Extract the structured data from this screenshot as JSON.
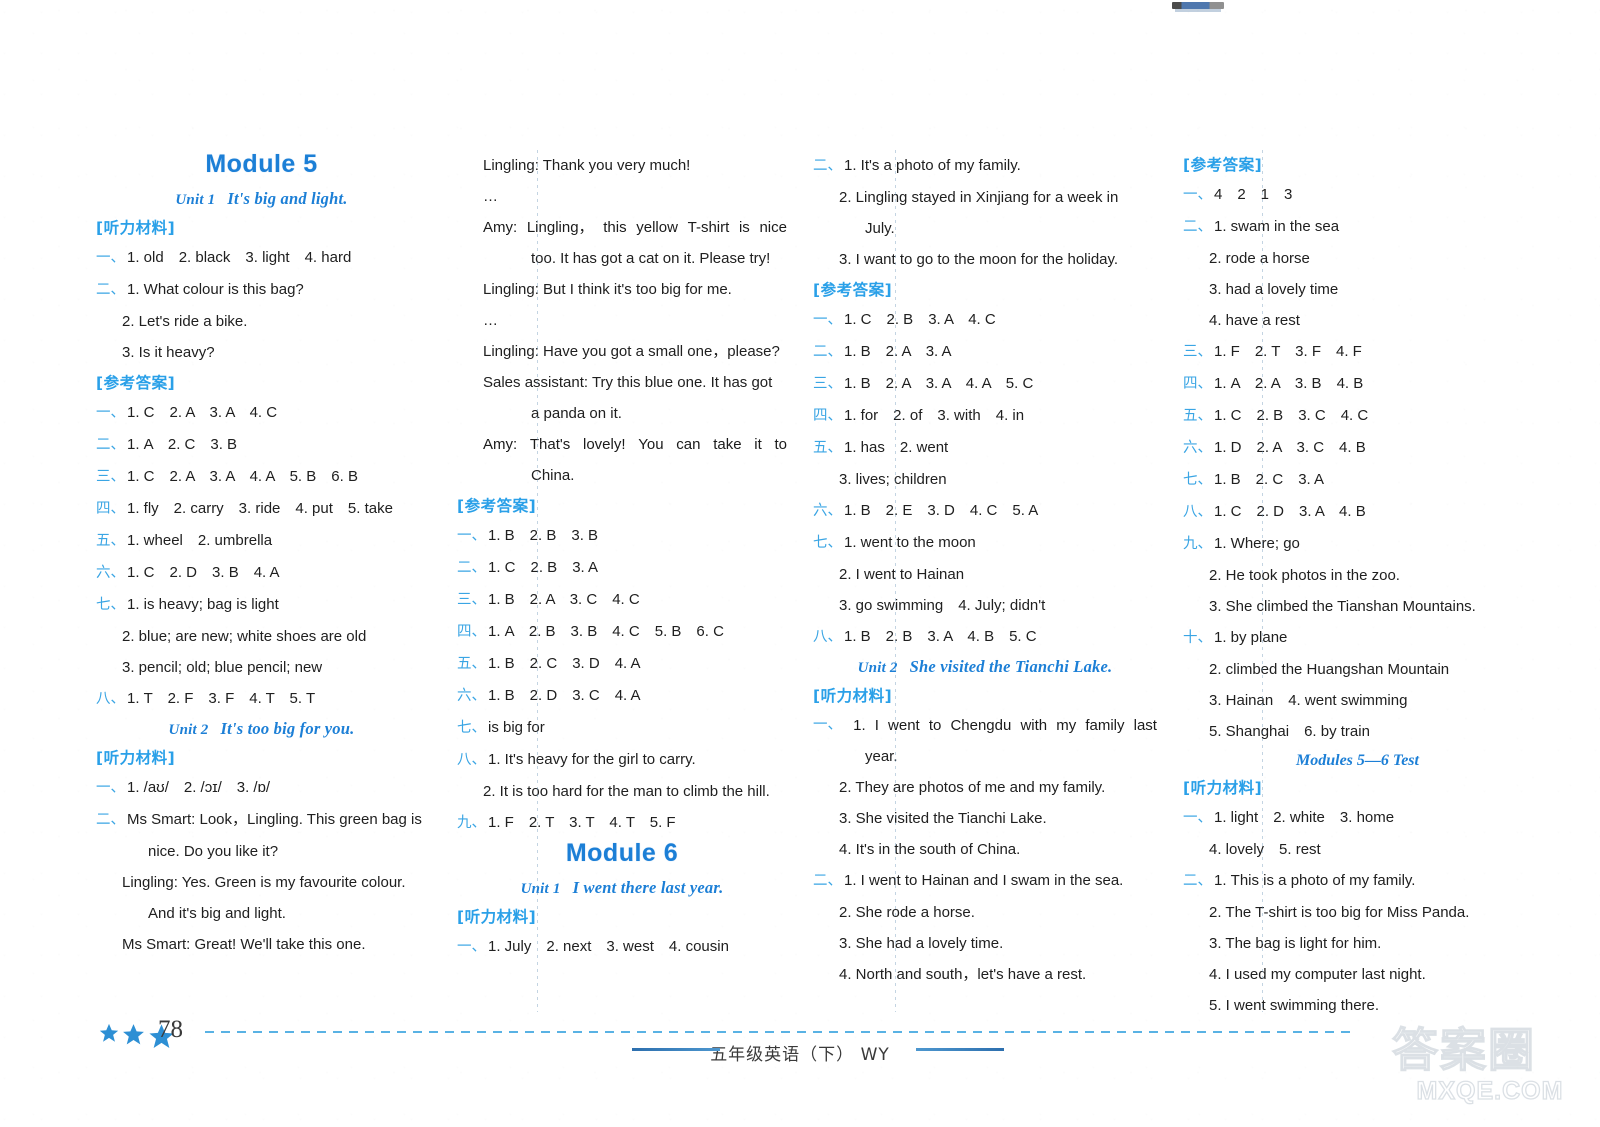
{
  "page": {
    "number": "78",
    "footer_center": "五年级英语（下）  WY",
    "watermark_cn": "答案圈",
    "watermark_en": "MXQE.COM"
  },
  "labels": {
    "listening": "[听力材料]",
    "answers": "[参考答案]"
  },
  "columns": [
    {
      "id": "col-1",
      "blocks": [
        {
          "type": "module",
          "text": "Module 5"
        },
        {
          "type": "unit",
          "no": "Unit 1",
          "title": "It's big and light."
        },
        {
          "type": "head",
          "key": "listening"
        },
        {
          "type": "line",
          "cn": "一",
          "text": "1. old　2. black　3. light　4. hard"
        },
        {
          "type": "line",
          "cn": "二",
          "text": "1. What colour is this bag?"
        },
        {
          "type": "line",
          "indent": 1,
          "text": "2. Let's ride a bike."
        },
        {
          "type": "line",
          "indent": 1,
          "text": "3. Is it heavy?"
        },
        {
          "type": "head",
          "key": "answers"
        },
        {
          "type": "line",
          "cn": "一",
          "text": "1. C　2. A　3. A　4. C"
        },
        {
          "type": "line",
          "cn": "二",
          "text": "1. A　2. C　3. B"
        },
        {
          "type": "line",
          "cn": "三",
          "text": "1. C　2. A　3. A　4. A　5. B　6. B"
        },
        {
          "type": "line",
          "cn": "四",
          "text": "1. fly　2. carry　3. ride　4. put　5. take"
        },
        {
          "type": "line",
          "cn": "五",
          "text": "1. wheel　2. umbrella"
        },
        {
          "type": "line",
          "cn": "六",
          "text": "1. C　2. D　3. B　4. A"
        },
        {
          "type": "line",
          "cn": "七",
          "text": "1. is heavy; bag is light"
        },
        {
          "type": "line",
          "indent": 1,
          "text": "2. blue; are new; white shoes are old"
        },
        {
          "type": "line",
          "indent": 1,
          "text": "3. pencil; old; blue pencil; new"
        },
        {
          "type": "line",
          "cn": "八",
          "text": "1. T　2. F　3. F　4. T　5. T"
        },
        {
          "type": "unit",
          "no": "Unit 2",
          "title": "It's too big for you."
        },
        {
          "type": "head",
          "key": "listening"
        },
        {
          "type": "line",
          "cn": "一",
          "text": "1. /aʊ/　2. /ɔɪ/　3. /ɒ/"
        },
        {
          "type": "line",
          "cn": "二",
          "text": "Ms Smart: Look，Lingling. This green bag is"
        },
        {
          "type": "line",
          "indent": 2,
          "text": "nice. Do you like it?"
        },
        {
          "type": "line",
          "indent": 1,
          "text": "Lingling: Yes. Green is my favourite colour."
        },
        {
          "type": "line",
          "indent": 2,
          "text": "And it's big and light."
        },
        {
          "type": "line",
          "indent": 1,
          "text": "Ms Smart: Great! We'll take this one."
        }
      ]
    },
    {
      "id": "col-2",
      "blocks": [
        {
          "type": "line",
          "indent": 1,
          "text": "Lingling: Thank you very much!"
        },
        {
          "type": "line",
          "indent": 1,
          "text": "…"
        },
        {
          "type": "just",
          "indent": 1,
          "words": [
            "Amy:",
            "Lingling，",
            "this",
            "yellow",
            "T-shirt",
            "is",
            "nice"
          ]
        },
        {
          "type": "line",
          "indent": 3,
          "text": "too. It has got a cat on it. Please try!"
        },
        {
          "type": "line",
          "indent": 1,
          "text": "Lingling: But I think it's too big for me."
        },
        {
          "type": "line",
          "indent": 1,
          "text": "…"
        },
        {
          "type": "line",
          "indent": 1,
          "text": "Lingling: Have you got a small one，please?"
        },
        {
          "type": "line",
          "indent": 1,
          "text": "Sales assistant: Try this blue one. It has got"
        },
        {
          "type": "line",
          "indent": 3,
          "text": "a panda on it."
        },
        {
          "type": "just",
          "indent": 1,
          "words": [
            "Amy:",
            "That's",
            "lovely!",
            "You",
            "can",
            "take",
            "it",
            "to"
          ]
        },
        {
          "type": "line",
          "indent": 3,
          "text": "China."
        },
        {
          "type": "head",
          "key": "answers"
        },
        {
          "type": "line",
          "cn": "一",
          "text": "1. B　2. B　3. B"
        },
        {
          "type": "line",
          "cn": "二",
          "text": "1. C　2. B　3. A"
        },
        {
          "type": "line",
          "cn": "三",
          "text": "1. B　2. A　3. C　4. C"
        },
        {
          "type": "line",
          "cn": "四",
          "text": "1. A　2. B　3. B　4. C　5. B　6. C"
        },
        {
          "type": "line",
          "cn": "五",
          "text": "1. B　2. C　3. D　4. A"
        },
        {
          "type": "line",
          "cn": "六",
          "text": "1. B　2. D　3. C　4. A"
        },
        {
          "type": "line",
          "cn": "七",
          "text": "is big for"
        },
        {
          "type": "line",
          "cn": "八",
          "text": "1. It's heavy for the girl to carry."
        },
        {
          "type": "line",
          "indent": 1,
          "text": "2. It is too hard for the man to climb the hill."
        },
        {
          "type": "line",
          "cn": "九",
          "text": "1. F　2. T　3. T　4. T　5. F"
        },
        {
          "type": "module",
          "text": "Module 6"
        },
        {
          "type": "unit",
          "no": "Unit 1",
          "title": "I went there last year."
        },
        {
          "type": "head",
          "key": "listening"
        },
        {
          "type": "line",
          "cn": "一",
          "text": "1. July　2. next　3. west　4. cousin"
        }
      ]
    },
    {
      "id": "col-3",
      "blocks": [
        {
          "type": "line",
          "cn": "二",
          "text": "1. It's a photo of my family."
        },
        {
          "type": "line",
          "indent": 1,
          "text": "2. Lingling stayed in Xinjiang for a week in"
        },
        {
          "type": "line",
          "indent": 2,
          "text": "July."
        },
        {
          "type": "line",
          "indent": 1,
          "text": "3. I want to go to the moon for the holiday."
        },
        {
          "type": "head",
          "key": "answers"
        },
        {
          "type": "line",
          "cn": "一",
          "text": "1. C　2. B　3. A　4. C"
        },
        {
          "type": "line",
          "cn": "二",
          "text": "1. B　2. A　3. A"
        },
        {
          "type": "line",
          "cn": "三",
          "text": "1. B　2. A　3. A　4. A　5. C"
        },
        {
          "type": "line",
          "cn": "四",
          "text": "1. for　2. of　3. with　4. in"
        },
        {
          "type": "line",
          "cn": "五",
          "text": "1. has　2. went"
        },
        {
          "type": "line",
          "indent": 1,
          "text": "3. lives; children"
        },
        {
          "type": "line",
          "cn": "六",
          "text": "1. B　2. E　3. D　4. C　5. A"
        },
        {
          "type": "line",
          "cn": "七",
          "text": "1. went to the moon"
        },
        {
          "type": "line",
          "indent": 1,
          "text": "2. I went to Hainan"
        },
        {
          "type": "line",
          "indent": 1,
          "text": "3. go swimming　4. July; didn't"
        },
        {
          "type": "line",
          "cn": "八",
          "text": "1. B　2. B　3. A　4. B　5. C"
        },
        {
          "type": "unit",
          "no": "Unit 2",
          "title": "She visited the Tianchi Lake."
        },
        {
          "type": "head",
          "key": "listening"
        },
        {
          "type": "just",
          "cn": "一",
          "words": [
            "1.",
            "I",
            "went",
            "to",
            "Chengdu",
            "with",
            "my",
            "family",
            "last"
          ]
        },
        {
          "type": "line",
          "indent": 2,
          "text": "year."
        },
        {
          "type": "line",
          "indent": 1,
          "text": "2. They are photos of me and my family."
        },
        {
          "type": "line",
          "indent": 1,
          "text": "3. She visited the Tianchi Lake."
        },
        {
          "type": "line",
          "indent": 1,
          "text": "4. It's in the south of China."
        },
        {
          "type": "line",
          "cn": "二",
          "text": "1. I went to Hainan and I swam in the sea."
        },
        {
          "type": "line",
          "indent": 1,
          "text": "2. She rode a horse."
        },
        {
          "type": "line",
          "indent": 1,
          "text": "3. She had a lovely time."
        },
        {
          "type": "line",
          "indent": 1,
          "text": "4. North and south，let's have a rest."
        }
      ]
    },
    {
      "id": "col-4",
      "blocks": [
        {
          "type": "head",
          "key": "answers"
        },
        {
          "type": "line",
          "cn": "一",
          "text": "4　2　1　3"
        },
        {
          "type": "line",
          "cn": "二",
          "text": "1. swam in the sea"
        },
        {
          "type": "line",
          "indent": 1,
          "text": "2. rode a horse"
        },
        {
          "type": "line",
          "indent": 1,
          "text": "3. had a lovely time"
        },
        {
          "type": "line",
          "indent": 1,
          "text": "4. have a rest"
        },
        {
          "type": "line",
          "cn": "三",
          "text": "1. F　2. T　3. F　4. F"
        },
        {
          "type": "line",
          "cn": "四",
          "text": "1. A　2. A　3. B　4. B"
        },
        {
          "type": "line",
          "cn": "五",
          "text": "1. C　2. B　3. C　4. C"
        },
        {
          "type": "line",
          "cn": "六",
          "text": "1. D　2. A　3. C　4. B"
        },
        {
          "type": "line",
          "cn": "七",
          "text": "1. B　2. C　3. A"
        },
        {
          "type": "line",
          "cn": "八",
          "text": "1. C　2. D　3. A　4. B"
        },
        {
          "type": "line",
          "cn": "九",
          "text": "1. Where; go"
        },
        {
          "type": "line",
          "indent": 1,
          "text": "2. He took photos in the zoo."
        },
        {
          "type": "line",
          "indent": 1,
          "text": "3. She climbed the Tianshan Mountains."
        },
        {
          "type": "line",
          "cn": "十",
          "text": "1. by plane"
        },
        {
          "type": "line",
          "indent": 1,
          "text": "2. climbed the Huangshan Mountain"
        },
        {
          "type": "line",
          "indent": 1,
          "text": "3. Hainan　4. went swimming"
        },
        {
          "type": "line",
          "indent": 1,
          "text": "5. Shanghai　6. by train"
        },
        {
          "type": "test",
          "text": "Modules 5—6 Test"
        },
        {
          "type": "head",
          "key": "listening"
        },
        {
          "type": "line",
          "cn": "一",
          "text": "1. light　2. white　3. home"
        },
        {
          "type": "line",
          "indent": 1,
          "text": "4. lovely　5. rest"
        },
        {
          "type": "line",
          "cn": "二",
          "text": "1. This is a photo of my family."
        },
        {
          "type": "line",
          "indent": 1,
          "text": "2. The T-shirt is too big for Miss Panda."
        },
        {
          "type": "line",
          "indent": 1,
          "text": "3. The bag is light for him."
        },
        {
          "type": "line",
          "indent": 1,
          "text": "4. I used my computer last night."
        },
        {
          "type": "line",
          "indent": 1,
          "text": "5. I went swimming there."
        }
      ]
    }
  ]
}
